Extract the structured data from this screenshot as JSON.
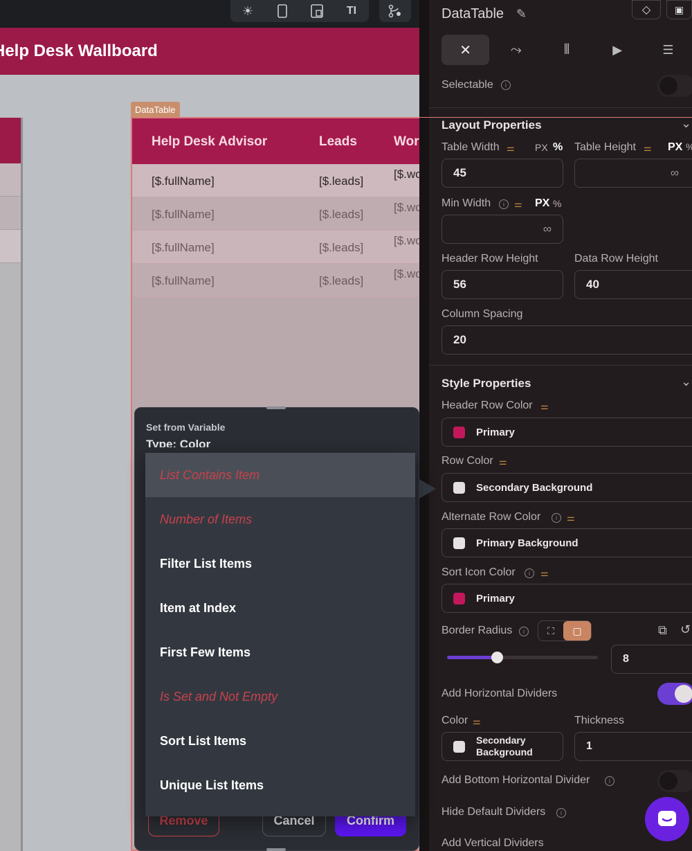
{
  "toolbar": {
    "icons": [
      "sun-icon",
      "phone-icon",
      "tablet-icon",
      "text-size-icon",
      "branch-icon"
    ]
  },
  "canvas": {
    "app_title": "Help Desk Wallboard",
    "component_tag": "DataTable",
    "table": {
      "headers": [
        "Help Desk Advisor",
        "Leads",
        "Wor"
      ],
      "rows": [
        {
          "name": "[$.fullName]",
          "leads": "[$.leads]",
          "work": "[$.wo"
        },
        {
          "name": "[$.fullName]",
          "leads": "[$.leads]",
          "work": "[$.wo"
        },
        {
          "name": "[$.fullName]",
          "leads": "[$.leads]",
          "work": "[$.wo"
        },
        {
          "name": "[$.fullName]",
          "leads": "[$.leads]",
          "work": "[$.wo"
        }
      ]
    }
  },
  "panel": {
    "title": "DataTable",
    "selectable_label": "Selectable",
    "layout": {
      "heading": "Layout Properties",
      "table_width_label": "Table Width",
      "table_width_value": "45",
      "table_height_label": "Table Height",
      "table_height_value": "∞",
      "unit_px": "PX",
      "unit_pct": "%",
      "min_width_label": "Min Width",
      "min_width_value": "∞",
      "header_row_height_label": "Header Row Height",
      "header_row_height_value": "56",
      "data_row_height_label": "Data Row Height",
      "data_row_height_value": "40",
      "column_spacing_label": "Column Spacing",
      "column_spacing_value": "20"
    },
    "style": {
      "heading": "Style Properties",
      "header_row_color_label": "Header Row Color",
      "header_row_color_value": "Primary",
      "row_color_label": "Row Color",
      "row_color_value": "Secondary Background",
      "alternate_row_color_label": "Alternate Row Color",
      "alternate_row_color_value": "Primary Background",
      "sort_icon_color_label": "Sort Icon Color",
      "sort_icon_color_value": "Primary",
      "border_radius_label": "Border Radius",
      "border_radius_value": "8",
      "border_radius_slider_fraction": 0.33,
      "add_horizontal_dividers_label": "Add Horizontal Dividers",
      "add_horizontal_dividers_on": true,
      "color_label": "Color",
      "divider_color_line1": "Secondary",
      "divider_color_line2": "Background",
      "thickness_label": "Thickness",
      "thickness_value": "1",
      "add_bottom_divider_label": "Add Bottom Horizontal Divider",
      "add_bottom_divider_on": false,
      "hide_default_dividers_label": "Hide Default Dividers",
      "add_vertical_dividers_label": "Add Vertical Dividers"
    },
    "colors": {
      "primary": "#c2185b",
      "secondary_background": "#e3dfe0",
      "primary_background": "#e6e2e3"
    }
  },
  "popover": {
    "heading": "Set from Variable",
    "type_label": "Type: Color",
    "menu_items": [
      {
        "label": "List Contains Item",
        "enabled": false
      },
      {
        "label": "Number of Items",
        "enabled": false
      },
      {
        "label": "Filter List Items",
        "enabled": true
      },
      {
        "label": "Item at Index",
        "enabled": true
      },
      {
        "label": "First Few Items",
        "enabled": true
      },
      {
        "label": "Is Set and Not Empty",
        "enabled": false
      },
      {
        "label": "Sort List Items",
        "enabled": true
      },
      {
        "label": "Unique List Items",
        "enabled": true
      }
    ],
    "remove_label": "Remove",
    "cancel_label": "Cancel",
    "confirm_label": "Confirm"
  }
}
